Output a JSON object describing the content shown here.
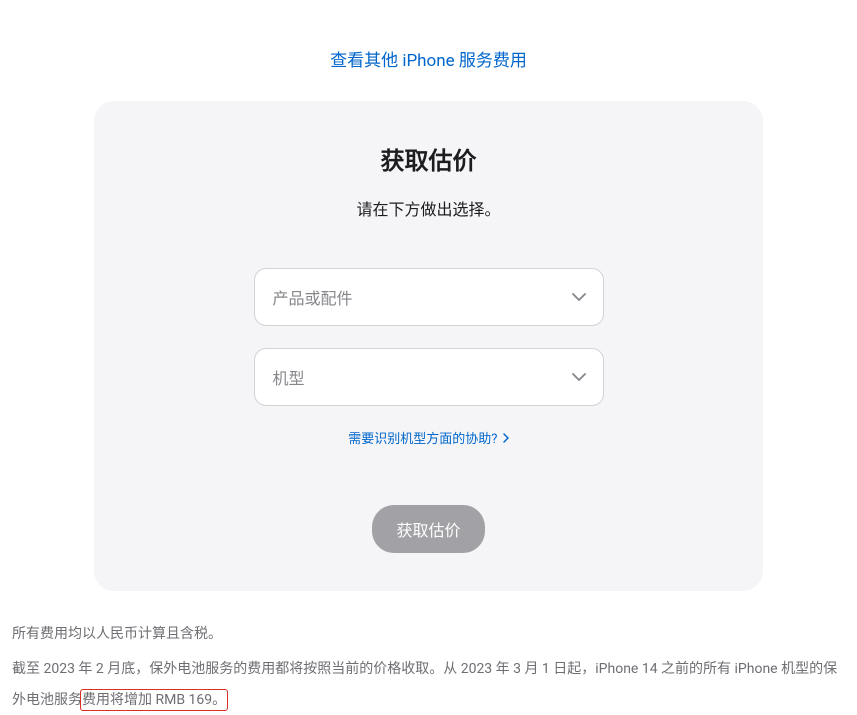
{
  "header": {
    "link_label": "查看其他 iPhone 服务费用"
  },
  "card": {
    "title": "获取估价",
    "subtitle": "请在下方做出选择。",
    "select_product_placeholder": "产品或配件",
    "select_model_placeholder": "机型",
    "help_link_label": "需要识别机型方面的协助?",
    "submit_label": "获取估价"
  },
  "footer": {
    "line1": "所有费用均以人民币计算且含税。",
    "line2_prefix": "截至 2023 年 2 月底，保外电池服务的费用都将按照当前的价格收取。从 2023 年 3 月 1 日起，iPhone 14 之前的所有 iPhone 机型的保外电池服务",
    "line2_highlight": "费用将增加 RMB 169。"
  }
}
